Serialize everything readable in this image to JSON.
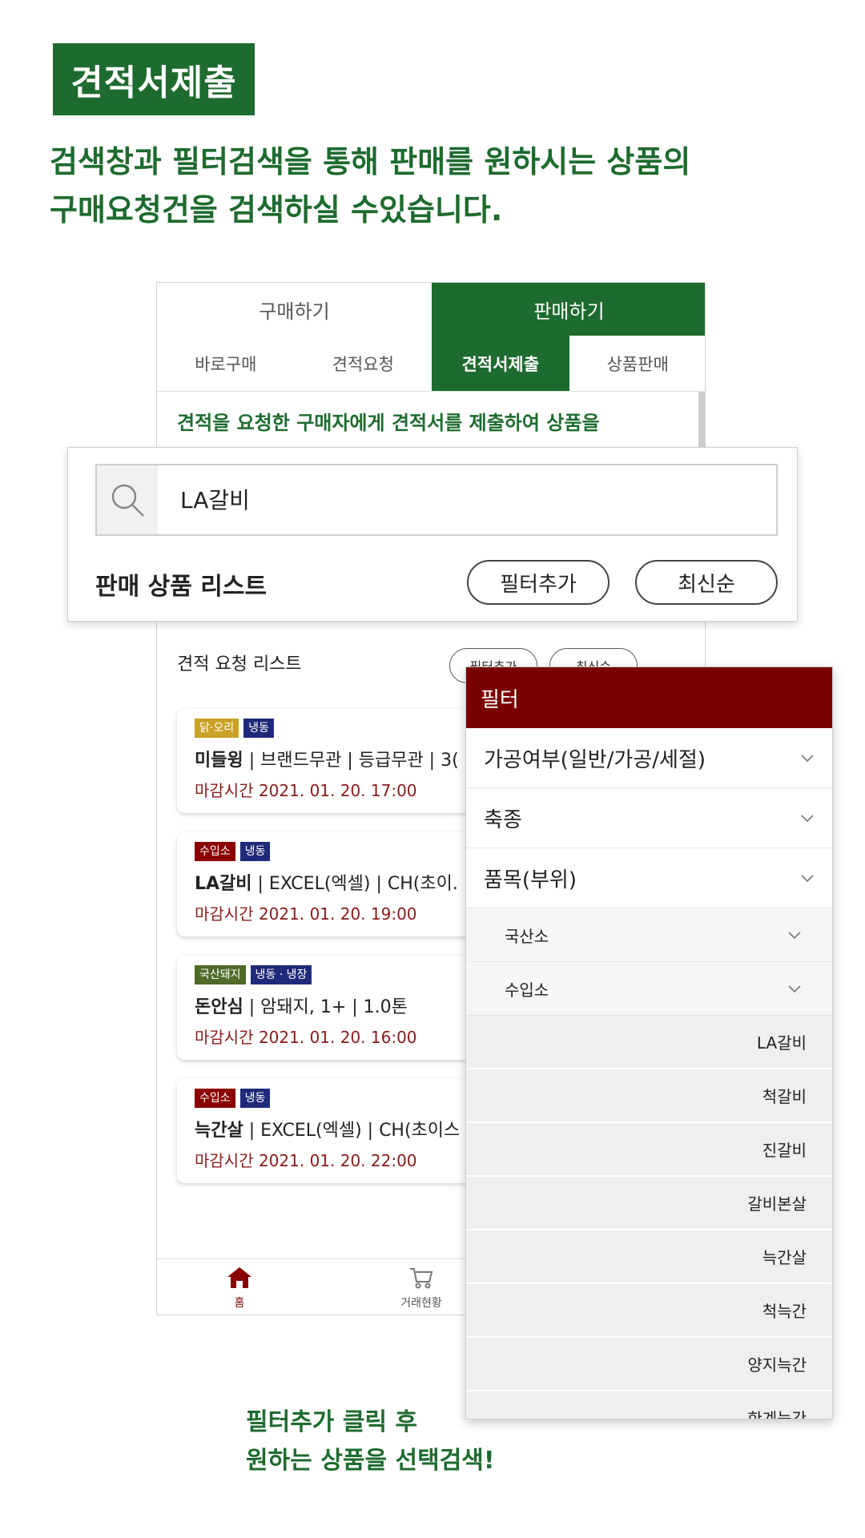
{
  "page": {
    "title_badge": "견적서제출",
    "intro_line1": "검색창과 필터검색을 통해 판매를 원하시는 상품의",
    "intro_line2": "구매요청건을 검색하실 수있습니다.",
    "caption_line1": "필터추가 클릭 후",
    "caption_line2": "원하는 상품을 선택검색!"
  },
  "phone": {
    "top_tabs": [
      {
        "label": "구매하기",
        "active": false
      },
      {
        "label": "판매하기",
        "active": true
      }
    ],
    "sub_tabs": [
      {
        "label": "바로구매"
      },
      {
        "label": "견적요청"
      },
      {
        "label": "견적서제출"
      },
      {
        "label": "상품판매"
      }
    ],
    "description": "견적을 요청한 구매자에게 견적서를 제출하여 상품을",
    "request_list_title": "견적 요청 리스트",
    "filter_btn": "필터추가",
    "sort_btn": "최신순",
    "cards": [
      {
        "tags": [
          "닭·오리",
          "냉동"
        ],
        "name": "미들윙",
        "detail": " | 브랜드무관 | 등급무관 | 3(",
        "deadline": "마감시간 2021. 01. 20. 17:00"
      },
      {
        "tags": [
          "수입소",
          "냉동"
        ],
        "name": "LA갈비",
        "detail": " | EXCEL(엑셀) | CH(초이.",
        "deadline": "마감시간 2021. 01. 20. 19:00"
      },
      {
        "tags": [
          "국산돼지",
          "냉동 · 냉장"
        ],
        "name": "돈안심",
        "detail": " | 암돼지, 1+ | 1.0톤",
        "deadline": "마감시간 2021. 01. 20. 16:00"
      },
      {
        "tags": [
          "수입소",
          "냉동"
        ],
        "name": "늑간살",
        "detail": " | EXCEL(엑셀) | CH(초이스",
        "deadline": "마감시간 2021. 01. 20. 22:00"
      }
    ],
    "nav": [
      {
        "label": "홈"
      },
      {
        "label": "거래현황"
      }
    ]
  },
  "search_panel": {
    "query": "LA갈비",
    "list_title": "판매 상품 리스트",
    "filter_btn": "필터추가",
    "sort_btn": "최신순"
  },
  "filter_panel": {
    "header": "필터",
    "rows": [
      "가공여부(일반/가공/세절)",
      "축종",
      "품목(부위)"
    ],
    "sub_rows": [
      "국산소",
      "수입소"
    ],
    "leaf_items": [
      "LA갈비",
      "척갈비",
      "진갈비",
      "갈비본살",
      "늑간살",
      "척늑간",
      "양지늑간",
      "한계늑간"
    ]
  },
  "colors": {
    "brand_green": "#1e6b2f",
    "filter_header": "#7a0000",
    "deadline": "#8b1a1a"
  }
}
